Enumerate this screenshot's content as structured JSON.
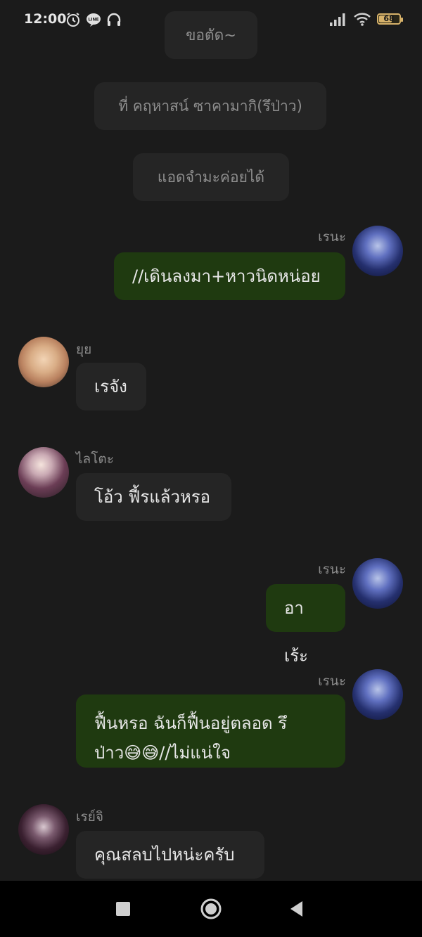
{
  "status_bar": {
    "time": "12:00",
    "left_icons": [
      "alarm-icon",
      "line-icon",
      "headphones-icon"
    ],
    "right_icons": [
      "signal-icon",
      "wifi-icon",
      "battery-icon"
    ],
    "battery_level": "68",
    "battery_fraction": 0.68
  },
  "system_messages": [
    "ขอตัด~",
    "ที่ คฤหาสน์ ซาคามากิ(รึป่าว)",
    "แอดจำมะค่อยได้"
  ],
  "messages": [
    {
      "sender": "เรนะ",
      "direction": "outgoing",
      "text": "//เดินลงมา+หาวนิดหน่อย"
    },
    {
      "sender": "ยุย",
      "direction": "incoming",
      "text": "เรจัง"
    },
    {
      "sender": "ไลโตะ",
      "direction": "incoming",
      "text": "โอ้ว ฟี้รแล้วหรอ"
    },
    {
      "sender": "เรนะ",
      "direction": "outgoing",
      "text": "อาเร้ะ"
    },
    {
      "sender": "เรนะ",
      "direction": "outgoing",
      "text_line1": "ฟื้นหรอ ฉันก็ฟื้นอยู่ตลอด รึ",
      "text_line2": "ป่าว😅😅//ไม่แน่ใจ"
    },
    {
      "sender": "เรย์จิ",
      "direction": "incoming",
      "text": "คุณสลบไปหน่ะครับ"
    }
  ],
  "nav_bar": {
    "buttons": [
      "recents-square-icon",
      "home-circle-icon",
      "back-triangle-icon"
    ]
  },
  "colors": {
    "background": "#1b1b1b",
    "incoming_bubble": "#252525",
    "outgoing_bubble": "#1f3a10",
    "name_text": "#8b8b8b",
    "battery": "#d7b26a"
  }
}
